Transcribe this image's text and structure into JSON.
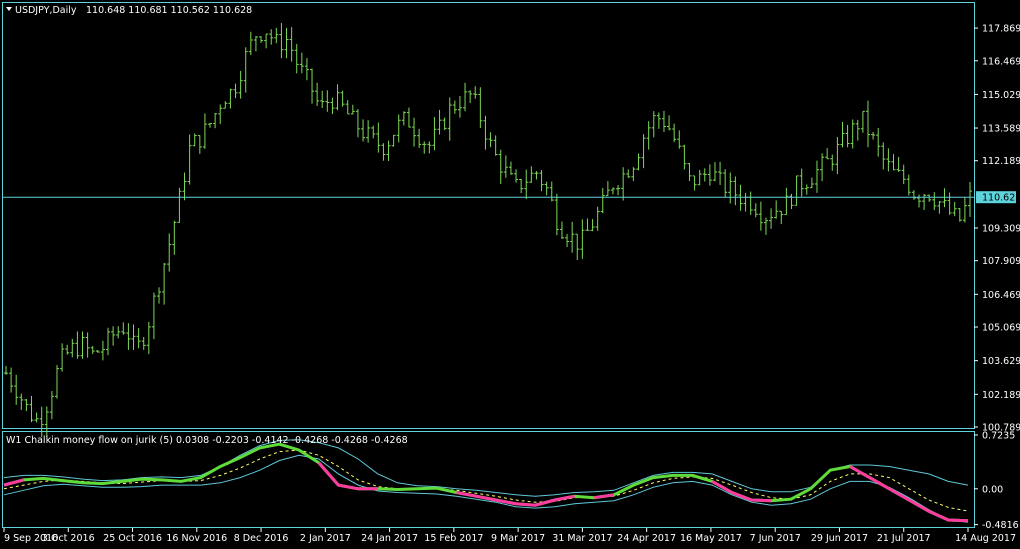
{
  "chart": {
    "symbol_header": "USDJPY,Daily",
    "ohlc_header": "110.648 110.681 110.562 110.628",
    "indicator_header": "W1 Chalkin money flow on jurik (5) 0.0308 -0.2203 -0.4142 -0.4268 -0.4268 -0.4268",
    "current_price_label": "110.628",
    "current_price": 110.628,
    "colors": {
      "background": "#000000",
      "frame": "#5fd3dc",
      "bars": "#7ed957",
      "indicator_up": "#5fdc3a",
      "indicator_down": "#ff3aa0",
      "signal_dotted": "#ffff66",
      "bands": "#5fc8d8",
      "text": "#ffffff"
    },
    "icons": {
      "menu": "triangle-down-icon"
    }
  },
  "chart_data": [
    {
      "type": "ohlc",
      "price_axis_ticks": [
        "117.869",
        "116.469",
        "115.029",
        "113.589",
        "112.189",
        "110.628",
        "109.309",
        "107.909",
        "106.469",
        "105.069",
        "103.629",
        "102.189",
        "100.789"
      ],
      "ylim": [
        100.789,
        118.9
      ],
      "time_axis_ticks": [
        "9 Sep 2016",
        "3 Oct 2016",
        "25 Oct 2016",
        "16 Nov 2016",
        "8 Dec 2016",
        "2 Jan 2017",
        "24 Jan 2017",
        "15 Feb 2017",
        "9 Mar 2017",
        "31 Mar 2017",
        "24 Apr 2017",
        "16 May 2017",
        "7 Jun 2017",
        "29 Jun 2017",
        "21 Jul 2017",
        "14 Aug 2017"
      ],
      "close_path": [
        103.1,
        102.4,
        101.5,
        101.0,
        102.0,
        103.6,
        104.1,
        104.3,
        103.9,
        104.2,
        104.8,
        105.1,
        104.0,
        105.0,
        106.8,
        108.5,
        110.5,
        112.8,
        113.2,
        113.9,
        114.9,
        115.2,
        116.5,
        117.6,
        117.8,
        117.2,
        117.4,
        116.2,
        115.5,
        114.4,
        114.9,
        114.5,
        113.9,
        113.4,
        113.0,
        112.8,
        113.6,
        114.0,
        113.4,
        112.8,
        113.5,
        114.4,
        114.8,
        115.0,
        113.8,
        112.5,
        111.8,
        111.0,
        111.4,
        111.7,
        110.9,
        109.5,
        109.0,
        108.6,
        109.4,
        110.2,
        111.2,
        111.6,
        112.2,
        113.4,
        114.1,
        113.8,
        112.8,
        111.3,
        111.4,
        111.8,
        111.2,
        110.9,
        110.6,
        110.4,
        109.8,
        110.1,
        110.3,
        111.1,
        111.4,
        111.8,
        112.2,
        112.8,
        113.4,
        114.0,
        113.1,
        112.2,
        111.6,
        111.4,
        110.7,
        110.9,
        110.5,
        110.0,
        109.6,
        110.628
      ]
    },
    {
      "type": "line",
      "title": "W1 Chalkin money flow on jurik (5)",
      "values_header": "0.0308 -0.2203 -0.4142 -0.4268 -0.4268 -0.4268",
      "axis_ticks": [
        "0.7235",
        "0.00",
        "-0.4816"
      ],
      "ylim": [
        -0.5,
        0.75
      ],
      "main_line": [
        0.05,
        0.12,
        0.14,
        0.11,
        0.08,
        0.07,
        0.1,
        0.13,
        0.12,
        0.1,
        0.15,
        0.3,
        0.42,
        0.55,
        0.6,
        0.52,
        0.35,
        0.05,
        0.0,
        0.0,
        -0.01,
        0.0,
        0.01,
        -0.05,
        -0.1,
        -0.15,
        -0.2,
        -0.22,
        -0.15,
        -0.1,
        -0.12,
        -0.08,
        0.05,
        0.15,
        0.18,
        0.18,
        0.1,
        -0.05,
        -0.15,
        -0.16,
        -0.14,
        0.0,
        0.25,
        0.3,
        0.15,
        0.0,
        -0.15,
        -0.3,
        -0.42,
        -0.43
      ],
      "main_line_down_segments": [
        [
          0,
          1
        ],
        [
          16,
          19
        ],
        [
          23,
          29
        ],
        [
          30,
          31
        ],
        [
          36,
          39
        ],
        [
          43,
          49
        ]
      ],
      "signal_dotted": [
        0.0,
        0.05,
        0.1,
        0.12,
        0.1,
        0.08,
        0.07,
        0.09,
        0.11,
        0.1,
        0.11,
        0.18,
        0.28,
        0.4,
        0.5,
        0.52,
        0.45,
        0.3,
        0.12,
        0.03,
        0.0,
        0.0,
        0.0,
        -0.02,
        -0.06,
        -0.1,
        -0.15,
        -0.18,
        -0.17,
        -0.12,
        -0.11,
        -0.1,
        -0.02,
        0.08,
        0.14,
        0.16,
        0.14,
        0.05,
        -0.05,
        -0.12,
        -0.14,
        -0.08,
        0.1,
        0.2,
        0.2,
        0.15,
        0.0,
        -0.15,
        -0.25,
        -0.3
      ],
      "upper_band": [
        0.15,
        0.18,
        0.18,
        0.16,
        0.13,
        0.11,
        0.12,
        0.15,
        0.16,
        0.15,
        0.18,
        0.3,
        0.45,
        0.58,
        0.65,
        0.66,
        0.62,
        0.55,
        0.4,
        0.2,
        0.08,
        0.04,
        0.03,
        0.0,
        -0.02,
        -0.05,
        -0.08,
        -0.1,
        -0.08,
        -0.05,
        -0.04,
        -0.02,
        0.08,
        0.18,
        0.22,
        0.22,
        0.2,
        0.1,
        0.0,
        -0.04,
        -0.04,
        0.02,
        0.25,
        0.32,
        0.32,
        0.3,
        0.25,
        0.2,
        0.1,
        0.05
      ],
      "lower_band": [
        -0.08,
        -0.02,
        0.04,
        0.06,
        0.04,
        0.02,
        0.02,
        0.03,
        0.05,
        0.05,
        0.05,
        0.08,
        0.15,
        0.25,
        0.38,
        0.45,
        0.4,
        0.2,
        0.05,
        -0.03,
        -0.05,
        -0.06,
        -0.07,
        -0.1,
        -0.14,
        -0.18,
        -0.24,
        -0.26,
        -0.24,
        -0.2,
        -0.18,
        -0.16,
        -0.08,
        0.02,
        0.08,
        0.1,
        0.05,
        -0.08,
        -0.18,
        -0.22,
        -0.2,
        -0.14,
        0.0,
        0.1,
        0.1,
        0.02,
        -0.12,
        -0.28,
        -0.42,
        -0.45
      ]
    }
  ]
}
